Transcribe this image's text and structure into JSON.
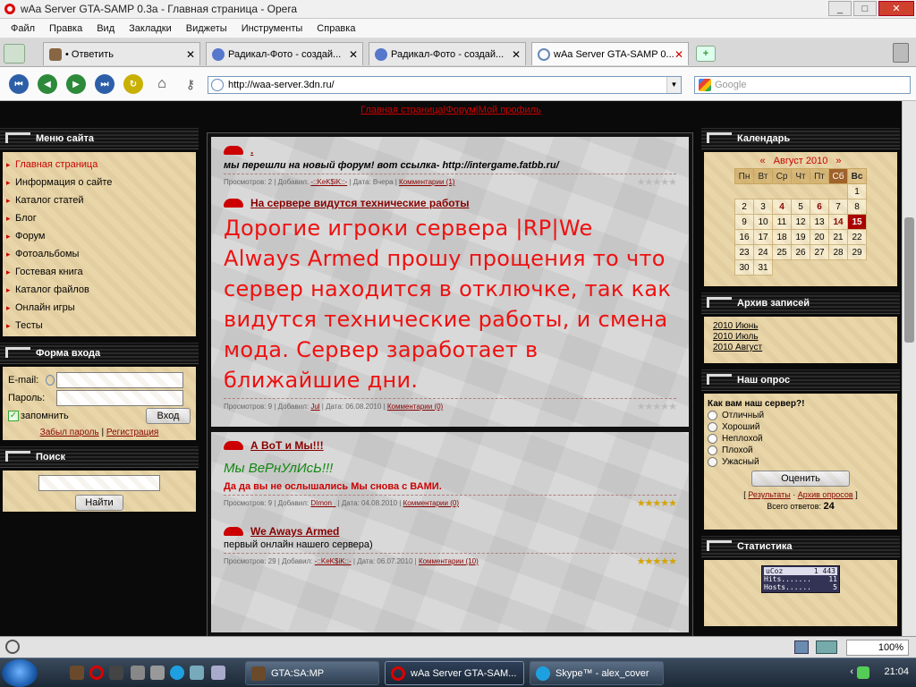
{
  "window": {
    "title": "wAa Server GTA-SAMP 0.3a - Главная страница - Opera"
  },
  "menubar": [
    "Файл",
    "Правка",
    "Вид",
    "Закладки",
    "Виджеты",
    "Инструменты",
    "Справка"
  ],
  "tabs": [
    {
      "label": "• Ответить"
    },
    {
      "label": "Радикал-Фото - создай..."
    },
    {
      "label": "Радикал-Фото - создай..."
    },
    {
      "label": "wAa Server GTA-SAMP 0..."
    }
  ],
  "address": {
    "url": "http://waa-server.3dn.ru/",
    "search_placeholder": "Google"
  },
  "topnav": {
    "home": "Главная страница",
    "forum": "Форум",
    "profile": "Мой профиль"
  },
  "left": {
    "menu_title": "Меню сайта",
    "menu_items": [
      "Главная страница",
      "Информация о сайте",
      "Каталог статей",
      "Блог",
      "Форум",
      "Фотоальбомы",
      "Гостевая книга",
      "Каталог файлов",
      "Онлайн игры",
      "Тесты"
    ],
    "login_title": "Форма входа",
    "email_label": "E-mail:",
    "password_label": "Пароль:",
    "remember_label": "запомнить",
    "login_button": "Вход",
    "forgot": "Забыл пароль",
    "register": "Регистрация",
    "search_title": "Поиск",
    "search_button": "Найти"
  },
  "posts": [
    {
      "title": ".",
      "body": "мы перешли на новый форум! вот ссылка- http://intergame.fatbb.ru/",
      "views": "Просмотров: 2",
      "author_label": "Добавил:",
      "author": "-::KeK$iK::-",
      "date": "Дата: Вчера",
      "comments": "Комментарии (1)"
    },
    {
      "title": "На сервере видутся технические работы",
      "body": "Дорогие игроки сервера |RP|We Always Armed прошу прощения то что сервер находится в отключке, так как видутся технические работы, и смена мода. Сервер заработает в ближайшие дни.",
      "views": "Просмотров: 9",
      "author_label": "Добавил:",
      "author": "Jul",
      "date": "Дата: 06.08.2010",
      "comments": "Комментарии (0)"
    },
    {
      "title": "А ВоТ и Мы!!!",
      "body_green": "Мы ВеРнУлИсЬ!!!",
      "body": "Да да вы не ослышались Мы снова с ВАМИ.",
      "views": "Просмотров: 9",
      "author_label": "Добавил:",
      "author": "DImon_",
      "date": "Дата: 04.08.2010",
      "comments": "Комментарии (0)"
    },
    {
      "title": "We Aways Armed",
      "body": "первый онлайн нашего сервера)",
      "views": "Просмотров: 29",
      "author_label": "Добавил:",
      "author": "-::KeK$iK::-",
      "date": "Дата: 06.07.2010",
      "comments": "Комментарии (10)"
    }
  ],
  "right": {
    "calendar_title": "Календарь",
    "calendar_month": "Август 2010",
    "prev": "«",
    "next": "»",
    "weekdays": [
      "Пн",
      "Вт",
      "Ср",
      "Чт",
      "Пт",
      "Сб",
      "Вс"
    ],
    "weeks": [
      [
        "",
        "",
        "",
        "",
        "",
        "",
        "1"
      ],
      [
        "2",
        "3",
        "4",
        "5",
        "6",
        "7",
        "8"
      ],
      [
        "9",
        "10",
        "11",
        "12",
        "13",
        "14",
        "15"
      ],
      [
        "16",
        "17",
        "18",
        "19",
        "20",
        "21",
        "22"
      ],
      [
        "23",
        "24",
        "25",
        "26",
        "27",
        "28",
        "29"
      ],
      [
        "30",
        "31",
        "",
        "",
        "",
        "",
        ""
      ]
    ],
    "archive_title": "Архив записей",
    "archive": [
      "2010 Июнь",
      "2010 Июль",
      "2010 Август"
    ],
    "poll_title": "Наш опрос",
    "poll_question": "Как вам наш сервер?!",
    "poll_options": [
      "Отличный",
      "Хороший",
      "Неплохой",
      "Плохой",
      "Ужасный"
    ],
    "vote_button": "Оценить",
    "results": "Результаты",
    "poll_archive": "Архив опросов",
    "total_label": "Всего ответов:",
    "total": "24",
    "stats_title": "Статистика",
    "counter": {
      "brand": "uCoz",
      "top": "1 443",
      "hits_label": "Hits.......",
      "hits": "11",
      "hosts_label": "Hosts......",
      "hosts": "5"
    }
  },
  "statusbar": {
    "zoom": "100%"
  },
  "taskbar": {
    "apps": [
      "GTA:SA:MP",
      "wAa Server GTA-SAM...",
      "Skype™ - alex_cover"
    ],
    "clock": "21:04"
  },
  "colors": {
    "accent_red": "#cc0000",
    "parchment": "#e8d5a8",
    "today": "#aa0000"
  }
}
